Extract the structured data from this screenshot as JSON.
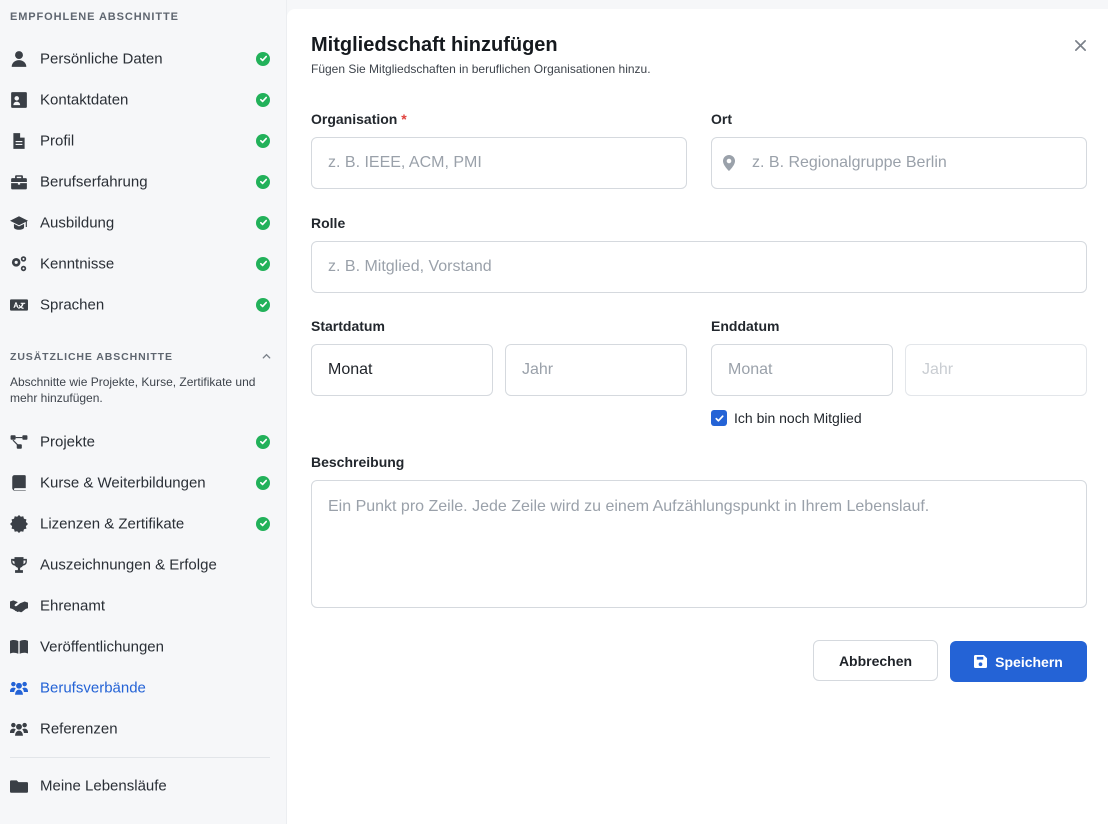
{
  "sidebar": {
    "recommended_heading": "EMPFOHLENE ABSCHNITTE",
    "recommended": [
      {
        "label": "Persönliche Daten",
        "icon": "user-icon",
        "done": true
      },
      {
        "label": "Kontaktdaten",
        "icon": "contact-card-icon",
        "done": true
      },
      {
        "label": "Profil",
        "icon": "document-icon",
        "done": true
      },
      {
        "label": "Berufserfahrung",
        "icon": "briefcase-icon",
        "done": true
      },
      {
        "label": "Ausbildung",
        "icon": "graduation-cap-icon",
        "done": true
      },
      {
        "label": "Kenntnisse",
        "icon": "gears-icon",
        "done": true
      },
      {
        "label": "Sprachen",
        "icon": "language-icon",
        "done": true
      }
    ],
    "additional_heading": "ZUSÄTZLICHE ABSCHNITTE",
    "additional_description": "Abschnitte wie Projekte, Kurse, Zertifikate und mehr hinzufügen.",
    "additional": [
      {
        "label": "Projekte",
        "icon": "diagram-icon",
        "done": true
      },
      {
        "label": "Kurse & Weiterbildungen",
        "icon": "book-icon",
        "done": true
      },
      {
        "label": "Lizenzen & Zertifikate",
        "icon": "certificate-icon",
        "done": true
      },
      {
        "label": "Auszeichnungen & Erfolge",
        "icon": "trophy-icon",
        "done": false
      },
      {
        "label": "Ehrenamt",
        "icon": "handshake-icon",
        "done": false
      },
      {
        "label": "Veröffentlichungen",
        "icon": "open-book-icon",
        "done": false
      },
      {
        "label": "Berufsverbände",
        "icon": "people-group-icon",
        "done": false,
        "active": true
      },
      {
        "label": "Referenzen",
        "icon": "people-icon",
        "done": false
      }
    ],
    "footer_item": {
      "label": "Meine Lebensläufe",
      "icon": "folder-icon"
    }
  },
  "form": {
    "title": "Mitgliedschaft hinzufügen",
    "subtitle": "Fügen Sie Mitgliedschaften in beruflichen Organisationen hinzu.",
    "organisation": {
      "label": "Organisation",
      "required_mark": "*",
      "placeholder": "z. B. IEEE, ACM, PMI",
      "value": ""
    },
    "location": {
      "label": "Ort",
      "placeholder": "z. B. Regionalgruppe Berlin",
      "value": ""
    },
    "role": {
      "label": "Rolle",
      "placeholder": "z. B. Mitglied, Vorstand",
      "value": ""
    },
    "start": {
      "label": "Startdatum",
      "month_value": "Monat",
      "year_placeholder": "Jahr"
    },
    "end": {
      "label": "Enddatum",
      "month_placeholder": "Monat",
      "year_placeholder": "Jahr"
    },
    "still_member": {
      "label": "Ich bin noch Mitglied",
      "checked": true
    },
    "description": {
      "label": "Beschreibung",
      "placeholder": "Ein Punkt pro Zeile. Jede Zeile wird zu einem Aufzählungspunkt in Ihrem Lebenslauf."
    },
    "cancel_label": "Abbrechen",
    "save_label": "Speichern"
  },
  "colors": {
    "accent": "#2463d6",
    "success": "#22b15a",
    "required": "#e0403c"
  }
}
